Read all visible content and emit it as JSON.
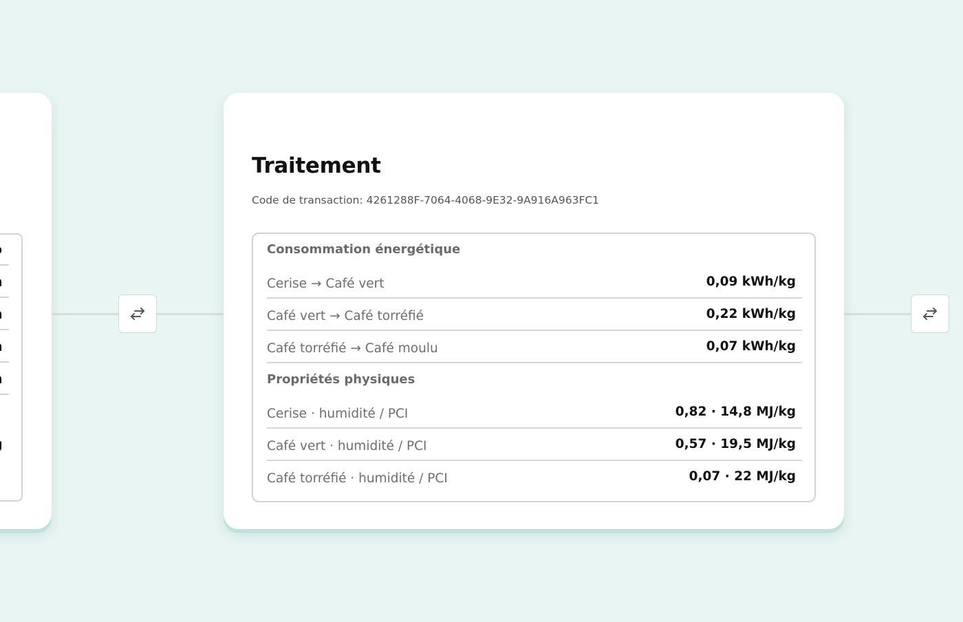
{
  "left_card": {
    "fragments": [
      "o",
      "n",
      "n",
      "n",
      "n",
      "g"
    ]
  },
  "main_card": {
    "title": "Traitement",
    "transaction_code": "Code de transaction: 4261288F-7064-4068-9E32-9A916A963FC1",
    "sections": [
      {
        "title": "Consommation énergétique",
        "rows": [
          {
            "label": "Cerise → Café vert",
            "value": "0,09 kWh/kg"
          },
          {
            "label": "Café vert → Café torréfié",
            "value": "0,22 kWh/kg"
          },
          {
            "label": "Café torréfié → Café moulu",
            "value": "0,07 kWh/kg"
          }
        ]
      },
      {
        "title": "Propriétés physiques",
        "rows": [
          {
            "label": "Cerise · humidité / PCI",
            "value": "0,82 · 14,8 MJ/kg"
          },
          {
            "label": "Café vert · humidité / PCI",
            "value": "0,57 · 19,5 MJ/kg"
          },
          {
            "label": "Café torréfié · humidité / PCI",
            "value": "0,07 · 22 MJ/kg"
          }
        ]
      }
    ]
  },
  "icons": {
    "swap": "swap-arrows-icon"
  }
}
